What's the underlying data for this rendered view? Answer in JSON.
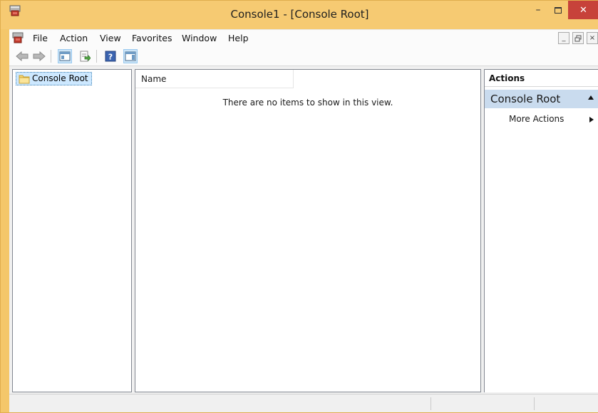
{
  "window": {
    "title": "Console1 - [Console Root]",
    "minimize_glyph": "–",
    "maximize_glyph": "□",
    "close_glyph": "✕"
  },
  "menubar": {
    "items": [
      "File",
      "Action",
      "View",
      "Favorites",
      "Window",
      "Help"
    ],
    "child_minimize": "_",
    "child_restore": " ̈",
    "child_close": "×"
  },
  "toolbar": {
    "buttons": [
      "back-arrow-icon",
      "forward-arrow-icon",
      "show-hide-console-tree-icon",
      "export-list-icon",
      "help-icon",
      "show-hide-action-pane-icon"
    ]
  },
  "tree": {
    "root_label": "Console Root"
  },
  "list": {
    "column_name": "Name",
    "empty_message": "There are no items to show in this view."
  },
  "actions": {
    "header": "Actions",
    "section_title": "Console Root",
    "more_actions": "More Actions"
  },
  "colors": {
    "frame": "#f6ca72",
    "close_button": "#c7423a",
    "selection": "#cde8ff",
    "action_section": "#c9dbee"
  }
}
